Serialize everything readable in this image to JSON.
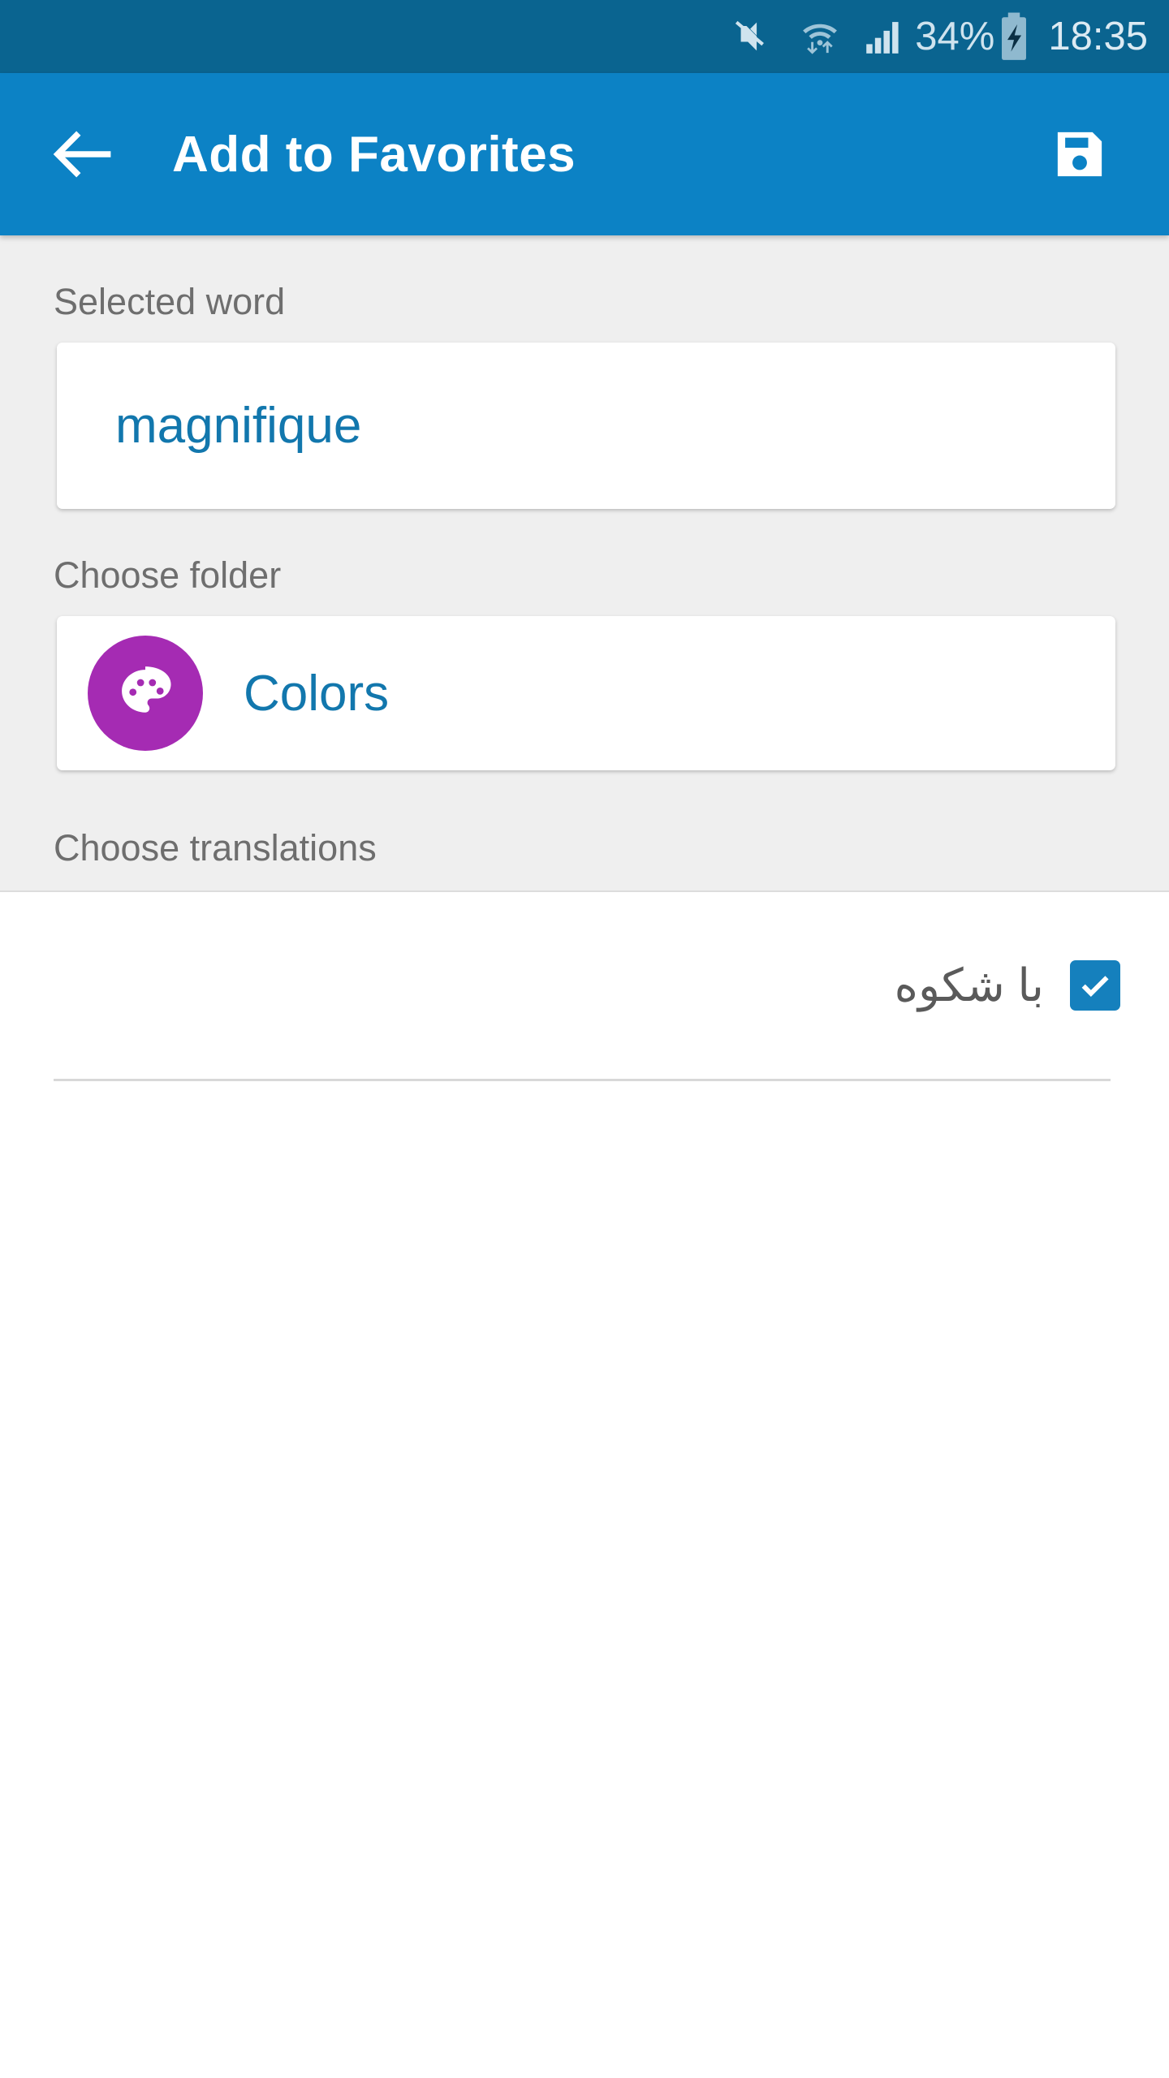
{
  "status_bar": {
    "mute_icon": "mute-icon",
    "wifi_icon": "wifi-transfer-icon",
    "signal_icon": "cellular-signal-icon",
    "battery_percent": "34%",
    "battery_icon": "battery-charging-icon",
    "clock": "18:35"
  },
  "app_bar": {
    "back_icon": "back-arrow-icon",
    "title": "Add to Favorites",
    "save_icon": "save-floppy-icon"
  },
  "form": {
    "selected_word_label": "Selected word",
    "selected_word_value": "magnifique",
    "selected_word_placeholder": "magnifique",
    "choose_folder_label": "Choose folder",
    "folder_icon": "palette-icon",
    "folder_name": "Colors",
    "choose_translations_label": "Choose translations"
  },
  "translations": [
    {
      "text": "با شکوه",
      "checked": true,
      "checkbox_icon": "checkmark-icon"
    }
  ],
  "colors": {
    "status_bar": "#0a6490",
    "app_bar": "#0c82c5",
    "accent_blue": "#1277ad",
    "checkbox_blue": "#1580bd",
    "folder_purple": "#a52bb3",
    "background_gray": "#efefef",
    "label_gray": "#6e6e6e"
  }
}
